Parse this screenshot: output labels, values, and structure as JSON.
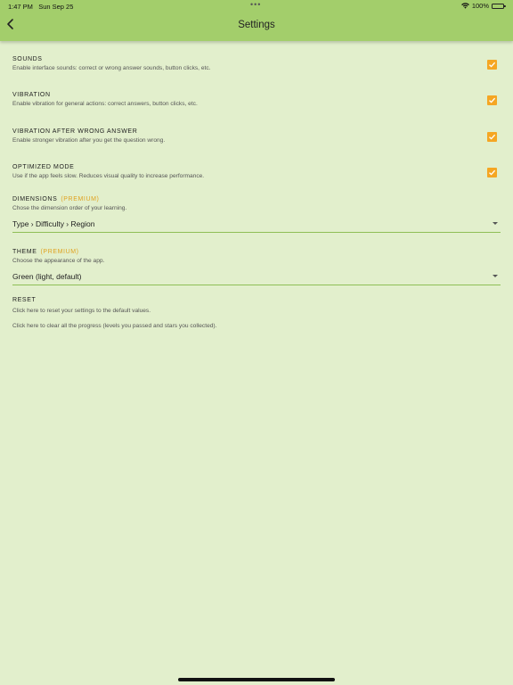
{
  "status_bar": {
    "time": "1:47 PM",
    "date": "Sun Sep 25",
    "dots": "•••",
    "battery": "100%"
  },
  "header": {
    "title": "Settings",
    "back_icon": "chevron-left-icon"
  },
  "settings": [
    {
      "title": "SOUNDS",
      "description": "Enable interface sounds: correct or wrong answer sounds, button clicks, etc.",
      "checked": true
    },
    {
      "title": "VIBRATION",
      "description": "Enable vibration for general actions: correct answers, button clicks, etc.",
      "checked": true
    },
    {
      "title": "VIBRATION AFTER WRONG ANSWER",
      "description": "Enable stronger vibration after you get the question wrong.",
      "checked": true
    },
    {
      "title": "OPTIMIZED MODE",
      "description": "Use if the app feels slow. Reduces visual quality to increase performance.",
      "checked": true
    }
  ],
  "dimensions": {
    "title": "DIMENSIONS",
    "badge": "(PREMIUM)",
    "description": "Chose the dimension order of your learning.",
    "value": "Type › Difficulty › Region"
  },
  "theme": {
    "title": "THEME",
    "badge": "(PREMIUM)",
    "description": "Choose the appearance of the app.",
    "value": "Green (light, default)"
  },
  "reset": {
    "title": "RESET",
    "reset_settings": "Click here to reset your settings to the default values.",
    "clear_progress": "Click here to clear all the progress (levels you passed and stars you collected)."
  },
  "colors": {
    "background": "#e2efcc",
    "header": "#a3ce6b",
    "accent": "#f5a623",
    "premium": "#e0a21f"
  }
}
